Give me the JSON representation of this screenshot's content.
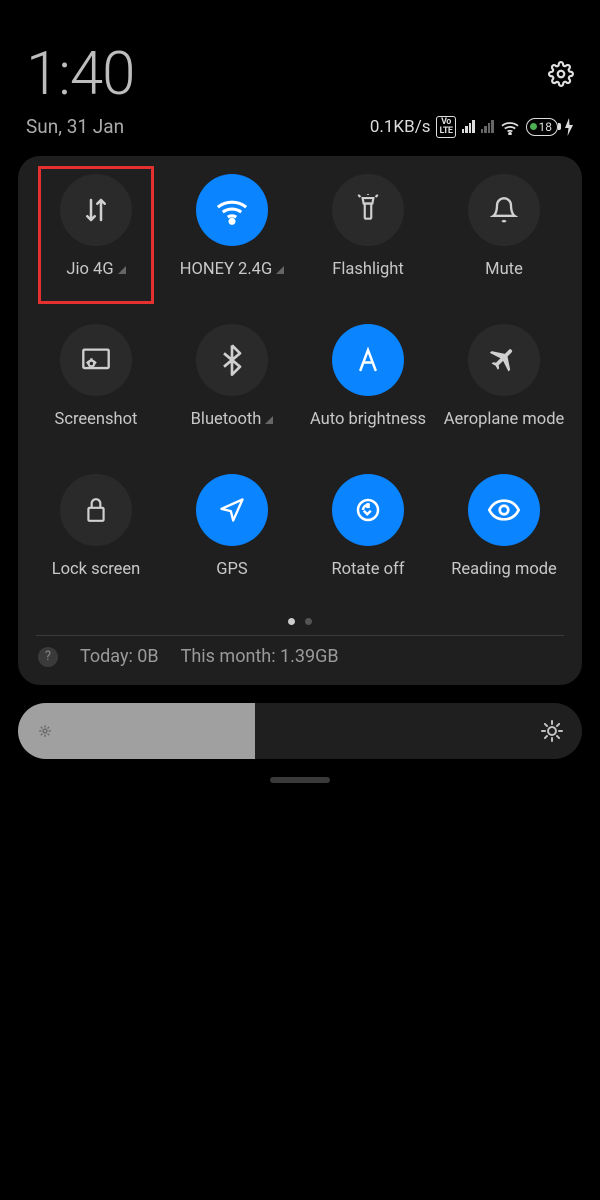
{
  "header": {
    "time": "1:40",
    "date": "Sun, 31 Jan",
    "net_speed": "0.1KB/s",
    "battery_pct": "18"
  },
  "tiles": [
    {
      "label": "Jio 4G",
      "on": false,
      "expandable": true,
      "highlight": true
    },
    {
      "label": "HONEY 2.4G",
      "on": true,
      "expandable": true,
      "highlight": false
    },
    {
      "label": "Flashlight",
      "on": false,
      "expandable": false,
      "highlight": false
    },
    {
      "label": "Mute",
      "on": false,
      "expandable": false,
      "highlight": false
    },
    {
      "label": "Screenshot",
      "on": false,
      "expandable": false,
      "highlight": false
    },
    {
      "label": "Bluetooth",
      "on": false,
      "expandable": true,
      "highlight": false
    },
    {
      "label": "Auto brightness",
      "on": true,
      "expandable": false,
      "highlight": false
    },
    {
      "label": "Aeroplane mode",
      "on": false,
      "expandable": false,
      "highlight": false
    },
    {
      "label": "Lock screen",
      "on": false,
      "expandable": false,
      "highlight": false
    },
    {
      "label": "GPS",
      "on": true,
      "expandable": false,
      "highlight": false
    },
    {
      "label": "Rotate off",
      "on": true,
      "expandable": false,
      "highlight": false
    },
    {
      "label": "Reading mode",
      "on": true,
      "expandable": false,
      "highlight": false
    }
  ],
  "pager": {
    "pages": 2,
    "active": 0
  },
  "usage": {
    "today": "Today: 0B",
    "month": "This month: 1.39GB"
  },
  "brightness": {
    "percent": 42
  }
}
